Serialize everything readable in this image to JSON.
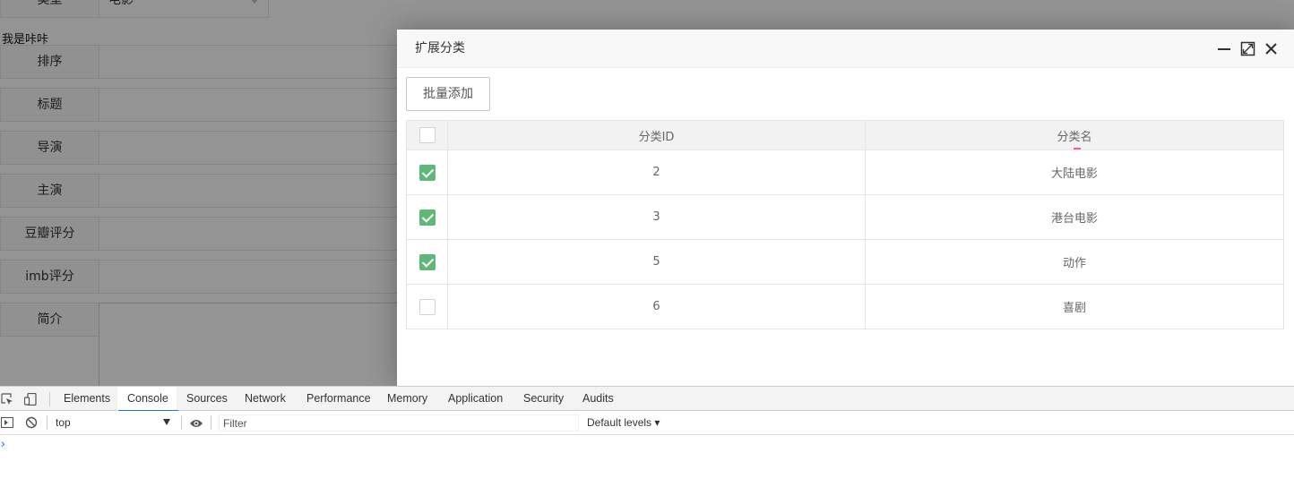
{
  "form": {
    "type_label": "类型",
    "type_value": "电影",
    "intro_text": "我是咔咔",
    "fields": [
      {
        "label": "排序"
      },
      {
        "label": "标题"
      },
      {
        "label": "导演"
      },
      {
        "label": "主演"
      },
      {
        "label": "豆瓣评分"
      },
      {
        "label": "imb评分"
      },
      {
        "label": "简介"
      }
    ]
  },
  "dialog": {
    "title": "扩展分类",
    "batch_add_label": "批量添加",
    "columns": [
      "分类ID",
      "分类名"
    ],
    "rows": [
      {
        "id": "2",
        "name": "大陆电影",
        "checked": true
      },
      {
        "id": "3",
        "name": "港台电影",
        "checked": true
      },
      {
        "id": "5",
        "name": "动作",
        "checked": true
      },
      {
        "id": "6",
        "name": "喜剧",
        "checked": false
      }
    ]
  },
  "devtools": {
    "tabs": [
      "Elements",
      "Console",
      "Sources",
      "Network",
      "Performance",
      "Memory",
      "Application",
      "Security",
      "Audits"
    ],
    "active_tab": "Console",
    "context": "top",
    "filter_placeholder": "Filter",
    "levels": "Default levels ▾",
    "prompt": "›"
  },
  "colors": {
    "accent": "#5fb878",
    "devtools_active": "#1a73e8",
    "sort_mark": "#ff5c8a"
  }
}
